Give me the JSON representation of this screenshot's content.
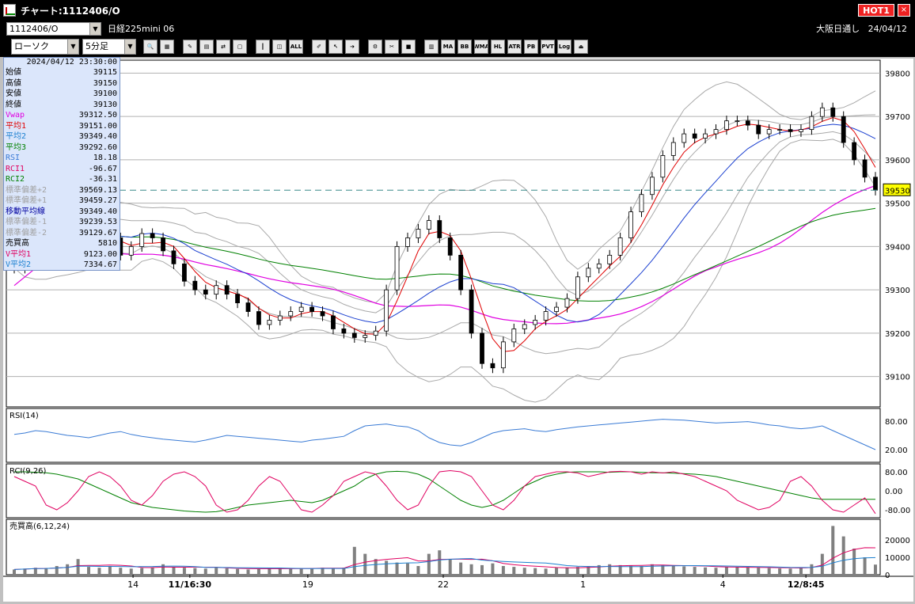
{
  "window": {
    "title": "チャート:1112406/O",
    "hot_label": "HOT1",
    "close_label": "×"
  },
  "infobar": {
    "symbol": "1112406/O",
    "instrument": "日経225mini 06",
    "session": "大阪日通し",
    "date": "24/04/12"
  },
  "toolbar": {
    "chart_type": "ローソク",
    "interval": "5分足",
    "buttons": [
      "zoom-icon",
      "layout-icon",
      "draw-icon",
      "chart-icon",
      "trade-icon",
      "memo-icon",
      "candle-icon",
      "split-icon",
      "ALL",
      "pen-icon",
      "cursor-icon",
      "arrow-icon",
      "gear-icon",
      "tool-icon",
      "color-icon",
      "bars-icon",
      "MA",
      "BB",
      "WMA",
      "HL",
      "ATR",
      "PB",
      "PVT",
      "Log",
      "exit-icon"
    ]
  },
  "datapanel": {
    "datetime": "2024/04/12  23:30:00",
    "rows": [
      {
        "label": "始値",
        "value": "39115",
        "color": "#000000"
      },
      {
        "label": "高値",
        "value": "39150",
        "color": "#000000"
      },
      {
        "label": "安値",
        "value": "39100",
        "color": "#000000"
      },
      {
        "label": "終値",
        "value": "39130",
        "color": "#000000"
      },
      {
        "label": "Vwap",
        "value": "39312.50",
        "color": "#e000e0"
      },
      {
        "label": "平均1",
        "value": "39151.00",
        "color": "#e00000"
      },
      {
        "label": "平均2",
        "value": "39349.40",
        "color": "#1a7fd0"
      },
      {
        "label": "平均3",
        "value": "39292.60",
        "color": "#008000"
      },
      {
        "label": "RSI",
        "value": "18.18",
        "color": "#3a7bd5"
      },
      {
        "label": "RCI1",
        "value": "-96.67",
        "color": "#e00060"
      },
      {
        "label": "RCI2",
        "value": "-36.31",
        "color": "#008000"
      },
      {
        "label": "標準偏差+2",
        "value": "39569.13",
        "color": "#a0a0a0"
      },
      {
        "label": "標準偏差+1",
        "value": "39459.27",
        "color": "#a0a0a0"
      },
      {
        "label": "移動平均線",
        "value": "39349.40",
        "color": "#0000a0"
      },
      {
        "label": "標準偏差-1",
        "value": "39239.53",
        "color": "#a0a0a0"
      },
      {
        "label": "標準偏差-2",
        "value": "39129.67",
        "color": "#a0a0a0"
      },
      {
        "label": "売買高",
        "value": "5810",
        "color": "#000000"
      },
      {
        "label": "V平均1",
        "value": "9123.00",
        "color": "#e00060"
      },
      {
        "label": "V平均2",
        "value": "7334.67",
        "color": "#1a7fd0"
      }
    ]
  },
  "chart_data": {
    "type": "line",
    "main": {
      "y_ticks": [
        39800,
        39700,
        39600,
        39500,
        39400,
        39300,
        39200,
        39100
      ],
      "ylim": [
        39030,
        39830
      ],
      "current_price_label": "39530",
      "current_price": 39530,
      "close_series": [
        39350,
        39390,
        39430,
        39460,
        39470,
        39490,
        39420,
        39440,
        39410,
        39420,
        39380,
        39400,
        39430,
        39420,
        39390,
        39360,
        39320,
        39300,
        39290,
        39310,
        39290,
        39270,
        39250,
        39220,
        39230,
        39240,
        39250,
        39260,
        39250,
        39240,
        39210,
        39200,
        39190,
        39195,
        39205,
        39300,
        39400,
        39420,
        39440,
        39460,
        39420,
        39380,
        39300,
        39200,
        39130,
        39120,
        39180,
        39210,
        39220,
        39230,
        39250,
        39260,
        39280,
        39330,
        39350,
        39360,
        39380,
        39420,
        39480,
        39520,
        39560,
        39610,
        39640,
        39660,
        39650,
        39660,
        39670,
        39690,
        39690,
        39680,
        39660,
        39670,
        39670,
        39665,
        39670,
        39700,
        39720,
        39700,
        39640,
        39600,
        39560,
        39530
      ],
      "ma1_color": "#e00000",
      "ma2_color": "#1a3fd0",
      "ma3_color": "#008000",
      "vwap_color": "#e000e0",
      "band_color": "#a8a8a8"
    },
    "rsi": {
      "label": "RSI(14)",
      "y_ticks": [
        "80.00",
        "20.00"
      ],
      "values": [
        52,
        55,
        60,
        58,
        54,
        50,
        48,
        45,
        50,
        55,
        58,
        52,
        48,
        45,
        42,
        40,
        38,
        36,
        40,
        45,
        50,
        48,
        46,
        44,
        42,
        40,
        38,
        36,
        40,
        42,
        45,
        48,
        60,
        70,
        72,
        74,
        70,
        68,
        60,
        45,
        35,
        30,
        28,
        35,
        45,
        55,
        60,
        62,
        64,
        60,
        58,
        62,
        65,
        68,
        70,
        72,
        74,
        76,
        78,
        80,
        82,
        84,
        83,
        82,
        80,
        78,
        76,
        77,
        78,
        79,
        76,
        72,
        70,
        66,
        64,
        66,
        70,
        60,
        50,
        40,
        30,
        20
      ]
    },
    "rci": {
      "label": "RCI(9,26)",
      "y_ticks": [
        "80.00",
        "0.00",
        "-80.00"
      ],
      "rci1": [
        60,
        40,
        20,
        -60,
        -80,
        -50,
        0,
        60,
        80,
        60,
        20,
        -40,
        -60,
        -20,
        40,
        70,
        80,
        60,
        20,
        -60,
        -90,
        -80,
        -40,
        20,
        60,
        40,
        -20,
        -80,
        -90,
        -60,
        -20,
        40,
        60,
        80,
        70,
        20,
        -40,
        -80,
        -60,
        20,
        80,
        85,
        80,
        60,
        0,
        -60,
        -80,
        -40,
        20,
        60,
        70,
        80,
        80,
        75,
        60,
        70,
        80,
        82,
        80,
        70,
        80,
        75,
        80,
        70,
        60,
        40,
        20,
        0,
        -40,
        -60,
        -80,
        -70,
        -40,
        40,
        60,
        20,
        -40,
        -80,
        -90,
        -60,
        -30,
        -96
      ],
      "rci2": [
        80,
        80,
        78,
        76,
        70,
        60,
        50,
        30,
        10,
        -10,
        -30,
        -50,
        -60,
        -70,
        -75,
        -80,
        -85,
        -88,
        -90,
        -88,
        -80,
        -70,
        -60,
        -55,
        -50,
        -45,
        -40,
        -45,
        -50,
        -40,
        -20,
        0,
        20,
        50,
        70,
        80,
        82,
        80,
        70,
        50,
        20,
        -10,
        -40,
        -60,
        -70,
        -60,
        -40,
        -10,
        20,
        40,
        60,
        70,
        78,
        80,
        80,
        80,
        78,
        80,
        80,
        78,
        76,
        76,
        74,
        72,
        70,
        66,
        60,
        50,
        40,
        30,
        20,
        10,
        0,
        -10,
        -20,
        -30,
        -36,
        -36,
        -36,
        -36,
        -36,
        -36
      ]
    },
    "volume": {
      "label": "売買高(6,12,24)",
      "y_ticks": [
        "20000",
        "10000",
        "0"
      ],
      "values": [
        3000,
        3500,
        4000,
        3800,
        5000,
        6000,
        9000,
        4500,
        4000,
        5000,
        4000,
        3500,
        3800,
        4200,
        6000,
        4500,
        4000,
        3800,
        3500,
        4000,
        3600,
        3300,
        3000,
        3200,
        3500,
        4000,
        3800,
        3600,
        3500,
        4000,
        3800,
        4000,
        16000,
        12000,
        9000,
        8000,
        7000,
        6500,
        5000,
        12000,
        14000,
        9000,
        7000,
        6000,
        5500,
        6500,
        5000,
        4500,
        4000,
        3800,
        3500,
        4000,
        4200,
        4500,
        5000,
        5500,
        6000,
        5500,
        5200,
        5000,
        6000,
        5500,
        5000,
        4800,
        4500,
        4200,
        4000,
        4300,
        4500,
        4200,
        4000,
        3800,
        3600,
        3500,
        4000,
        6000,
        12000,
        28000,
        22000,
        15000,
        10000,
        5810
      ],
      "ylim": [
        0,
        30000
      ]
    },
    "x_labels": [
      "14",
      "11/16:30",
      "19",
      "22",
      "1",
      "4",
      "12/8:45"
    ]
  }
}
